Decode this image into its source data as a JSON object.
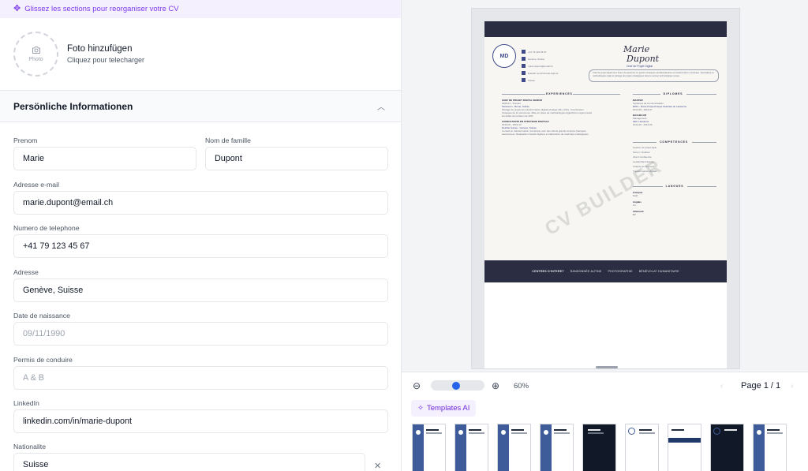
{
  "hint": {
    "text": "Glissez les sections pour reorganiser votre CV"
  },
  "photo": {
    "placeholder": "Photo",
    "title": "Foto hinzufügen",
    "subtitle": "Cliquez pour telecharger"
  },
  "section": {
    "title": "Persönliche Informationen"
  },
  "fields": {
    "prenom": {
      "label": "Prenom",
      "value": "Marie"
    },
    "nom": {
      "label": "Nom de famille",
      "value": "Dupont"
    },
    "email": {
      "label": "Adresse e-mail",
      "value": "marie.dupont@email.ch"
    },
    "phone": {
      "label": "Numero de telephone",
      "value": "+41 79 123 45 67"
    },
    "adresse": {
      "label": "Adresse",
      "value": "Genève, Suisse"
    },
    "birth": {
      "label": "Date de naissance",
      "placeholder": "09/11/1990"
    },
    "permis": {
      "label": "Permis de conduire",
      "placeholder": "A & B"
    },
    "linkedin": {
      "label": "LinkedIn",
      "value": "linkedin.com/in/marie-dupont"
    },
    "nationalite": {
      "label": "Nationalite",
      "value": "Suisse"
    }
  },
  "cv": {
    "initials": "MD",
    "first_name": "Marie",
    "last_name": "Dupont",
    "role": "Chef de Projet Digital",
    "contacts": [
      "+41 79 123 45 67",
      "Genève, Suisse",
      "marie.dupont@email.ch",
      "linkedin.com/in/marie-dupont",
      "Suisse"
    ],
    "summary": "Chef de projet digital avec 8 ans d'expérience en gestion d'équipes pluridisciplinaires et transformation numérique. Spécialisée en méthodologies Agile et pilotage de projets stratégiques dans le secteur technologique suisse.",
    "sections": {
      "experiences": "EXPERIENCES",
      "diplomes": "DIPLOMES",
      "competences": "COMPETENCES",
      "langues": "LANGUES"
    },
    "job1": {
      "title": "CHEF DE PROJET DIGITAL SENIOR",
      "date": "2020-01 - Present",
      "company": "Swisscom - Berne, Suisse",
      "desc1": "Pilotage de projets de transformation digitale (budget 2M+ CHF). Coordination",
      "desc2": "d'équipes de 12 personnes. Mise en place de méthodologies Agile/Scrum ayant réduit",
      "desc3": "les délais de livraison de 30%."
    },
    "job2": {
      "title": "CONSULTANTE EN STRATEGIE DIGITALE",
      "date": "2016-06 - 2019-12",
      "company": "Deloitte Suisse - Genève, Suisse",
      "desc1": "Conseil en transformation numérique pour des clients grands comptes (banques,",
      "desc2": "assurances). Réalisation d'audits digitaux et élaboration de roadmaps stratégiques."
    },
    "edu1": {
      "title": "MASTER",
      "sub": "Systèmes de Communication",
      "school": "EPFL - École Polytechnique Fédérale de Lausanne",
      "date": "2014-09 - 2016-07"
    },
    "edu2": {
      "title": "BACHELOR",
      "sub": "Management",
      "school": "HEC Lausanne",
      "date": "2011-09 - 2014-06"
    },
    "skills": [
      "Gestion de projet Agile",
      "Scrum / Kanban",
      "Jira & Confluence",
      "Leadership d'équipe",
      "Analyse de données",
      "Transformation digitale"
    ],
    "languages": [
      {
        "name": "Français",
        "level": "Natif"
      },
      {
        "name": "Anglais",
        "level": "C1"
      },
      {
        "name": "Allemand",
        "level": "B2"
      }
    ],
    "footer": {
      "label": "CENTRES D'INTERET",
      "items": [
        "RANDONNÉE ALPINE",
        "PHOTOGRAPHIE",
        "BÉNÉVOLAT HUMANITAIRE"
      ]
    },
    "watermark": "CV BUILDER"
  },
  "toolbar": {
    "zoom": "60%",
    "zoom_level": 0.6,
    "page_label": "Page 1 / 1",
    "templates_label": "Templates AI"
  }
}
